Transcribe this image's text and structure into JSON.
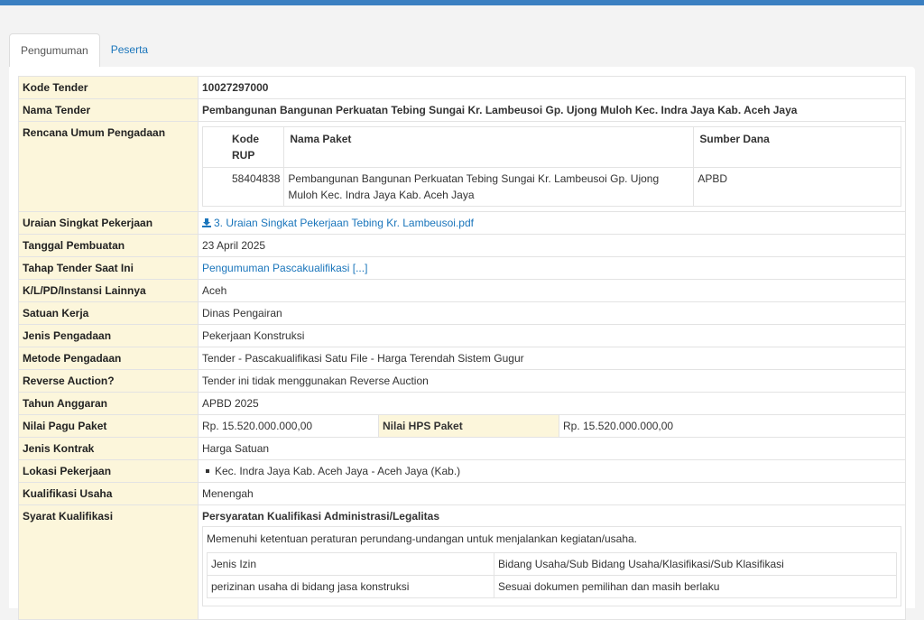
{
  "tabs": [
    "Pengumuman",
    "Peserta"
  ],
  "rows": {
    "kode_tender": {
      "label": "Kode Tender",
      "value": "10027297000"
    },
    "nama_tender": {
      "label": "Nama Tender",
      "value": "Pembangunan Bangunan Perkuatan Tebing Sungai Kr. Lambeusoi Gp. Ujong Muloh Kec. Indra Jaya Kab. Aceh Jaya"
    },
    "rup": {
      "label": "Rencana Umum Pengadaan",
      "headers": [
        "Kode RUP",
        "Nama Paket",
        "Sumber Dana"
      ],
      "row": [
        "58404838",
        "Pembangunan Bangunan Perkuatan Tebing Sungai Kr. Lambeusoi Gp. Ujong Muloh Kec. Indra Jaya Kab. Aceh Jaya",
        "APBD"
      ]
    },
    "uraian": {
      "label": "Uraian Singkat Pekerjaan",
      "value": "3. Uraian Singkat Pekerjaan Tebing Kr. Lambeusoi.pdf"
    },
    "tanggal": {
      "label": "Tanggal Pembuatan",
      "value": "23 April 2025"
    },
    "tahap": {
      "label": "Tahap Tender Saat Ini",
      "value": "Pengumuman Pascakualifikasi [...]"
    },
    "klpd": {
      "label": "K/L/PD/Instansi Lainnya",
      "value": "Aceh"
    },
    "satker": {
      "label": "Satuan Kerja",
      "value": "Dinas Pengairan"
    },
    "jenis_pengadaan": {
      "label": "Jenis Pengadaan",
      "value": "Pekerjaan Konstruksi"
    },
    "metode": {
      "label": "Metode Pengadaan",
      "value": "Tender - Pascakualifikasi Satu File - Harga Terendah Sistem Gugur"
    },
    "reverse": {
      "label": "Reverse Auction?",
      "value": "Tender ini tidak menggunakan Reverse Auction"
    },
    "tahun": {
      "label": "Tahun Anggaran",
      "value": "APBD 2025"
    },
    "pagu": {
      "label": "Nilai Pagu Paket",
      "value": "Rp. 15.520.000.000,00",
      "hps_label": "Nilai HPS Paket",
      "hps_value": "Rp. 15.520.000.000,00"
    },
    "kontrak": {
      "label": "Jenis Kontrak",
      "value": "Harga Satuan"
    },
    "lokasi": {
      "label": "Lokasi Pekerjaan",
      "value": "Kec. Indra Jaya Kab. Aceh Jaya - Aceh Jaya (Kab.)"
    },
    "kualifikasi_usaha": {
      "label": "Kualifikasi Usaha",
      "value": "Menengah"
    },
    "syarat": {
      "label": "Syarat Kualifikasi",
      "heading": "Persyaratan Kualifikasi Administrasi/Legalitas",
      "text": "Memenuhi ketentuan peraturan perundang-undangan untuk menjalankan kegiatan/usaha.",
      "headers": [
        "Jenis Izin",
        "Bidang Usaha/Sub Bidang Usaha/Klasifikasi/Sub Klasifikasi"
      ],
      "row": [
        "perizinan usaha di bidang jasa konstruksi",
        "Sesuai dokumen pemilihan dan masih berlaku"
      ]
    }
  }
}
